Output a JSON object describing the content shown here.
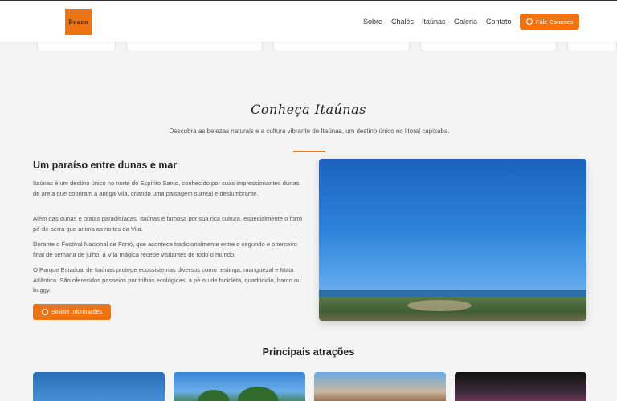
{
  "header": {
    "logo_text": "Bcaco",
    "nav": [
      {
        "label": "Sobre"
      },
      {
        "label": "Chalés"
      },
      {
        "label": "Itaúnas"
      },
      {
        "label": "Galeria"
      },
      {
        "label": "Contato"
      }
    ],
    "cta_label": "Fale Conosco"
  },
  "section": {
    "title": "Conheça Itaúnas",
    "subtitle": "Descubra as belezas naturais e a cultura vibrante de Itaúnas, um destino único no litoral capixaba.",
    "heading": "Um paraíso entre dunas e mar",
    "paragraphs": [
      "Itaúnas é um destino único no norte do Espírito Santo, conhecido por suas impressionantes dunas de areia que cobriram a antiga Vila, criando uma paisagem surreal e deslumbrante.",
      "Além das dunas e praias paradisíacas, Itaúnas é famosa por sua rica cultura, especialmente o forró pé-de-serra que anima as noites da Vila.",
      "Durante o Festival Nacional de Forró, que acontece tradicionalmente entre o segundo e o terceiro final de semana de julho, a Vila mágica recebe visitantes de todo o mundo.",
      "O Parque Estadual de Itaúnas protege ecossistemas diversos como restinga, manguezal e Mata Atlântica. São oferecidos passeios por trilhas ecológicas, a pé ou de bicicleta, quadriciclo, barco ou buggy."
    ],
    "info_button": "Solicite Informações"
  },
  "attractions": {
    "title": "Principais atrações"
  },
  "colors": {
    "accent": "#f07312",
    "background": "#f4f4f4"
  }
}
